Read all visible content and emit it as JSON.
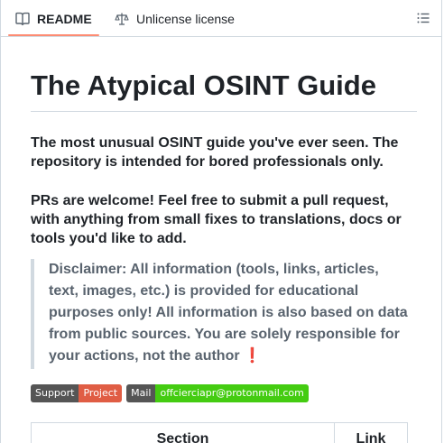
{
  "tabs": {
    "readme_label": "README",
    "license_label": "Unlicense license"
  },
  "readme": {
    "title": "The Atypical OSINT Guide",
    "intro": "The most unusual OSINT guide you've ever seen. The repository is intended for bored professionals only.",
    "contribute": "PRs are welcome! Feel free to submit a pull request, with anything from small fixes to translations, docs or tools you'd like to add.",
    "disclaimer": "Disclaimer: All information (tools, links, articles, text, images, etc.) is provided for educational purposes only! All information is also based on data from public sources. You are solely responsible for your actions, not the author",
    "disclaimer_mark": "❗",
    "badges": [
      {
        "label": "Support",
        "value": "Project",
        "color": "#e05d44"
      },
      {
        "label": "Mail",
        "value": "offcierciapr@protonmail.com",
        "color": "#4c1"
      }
    ],
    "table_headers": {
      "section": "Section",
      "link": "Link"
    }
  },
  "colors": {
    "accent_underline": "#fd8c73",
    "border": "#d1d9e0",
    "quote_text": "#59636e"
  },
  "icons": [
    "book-icon",
    "scale-icon",
    "list-icon"
  ]
}
